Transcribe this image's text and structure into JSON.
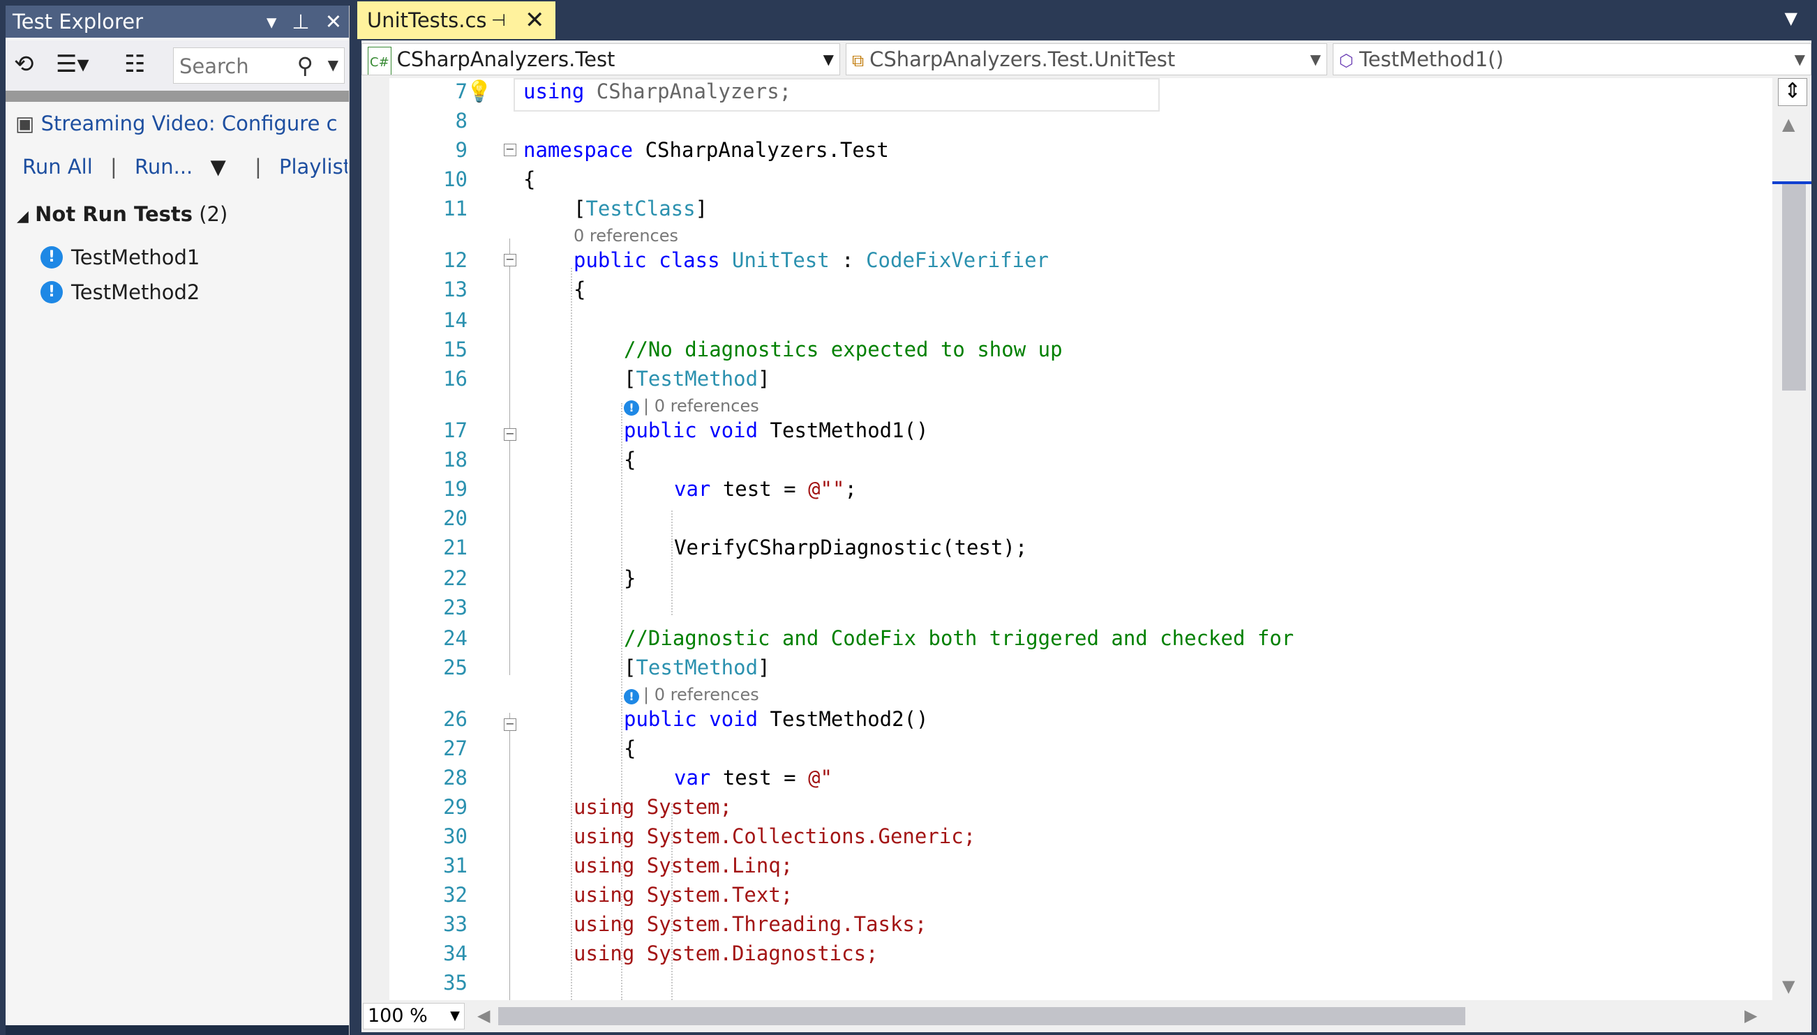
{
  "test_explorer": {
    "title": "Test Explorer",
    "search_placeholder": "Search",
    "playlist_label": "Streaming Video: Configure c",
    "actions": {
      "run_all": "Run All",
      "run": "Run...",
      "playlist": "Playlist : All T"
    },
    "group": {
      "label": "Not Run Tests",
      "count": "(2)"
    },
    "tests": [
      "TestMethod1",
      "TestMethod2"
    ]
  },
  "editor": {
    "tab": {
      "title": "UnitTests.cs"
    },
    "nav": {
      "project": "CSharpAnalyzers.Test",
      "type": "CSharpAnalyzers.Test.UnitTest",
      "member": "TestMethod1()"
    },
    "zoom": "100 %",
    "references_label": "0 references",
    "line_numbers": [
      "7",
      "8",
      "9",
      "10",
      "11",
      "12",
      "13",
      "14",
      "15",
      "16",
      "17",
      "18",
      "19",
      "20",
      "21",
      "22",
      "23",
      "24",
      "25",
      "26",
      "27",
      "28",
      "29",
      "30",
      "31",
      "32",
      "33",
      "34",
      "35"
    ],
    "code": {
      "l7_kw": "using",
      "l7_rest": " CSharpAnalyzers;",
      "l9_kw": "namespace",
      "l9_rest": " CSharpAnalyzers.Test",
      "l10": "{",
      "l11_a": "[",
      "l11_t": "TestClass",
      "l11_b": "]",
      "l12_kw1": "public",
      "l12_kw2": "class",
      "l12_t": "UnitTest",
      "l12_sep": " : ",
      "l12_base": "CodeFixVerifier",
      "l13": "{",
      "l15": "//No diagnostics expected to show up",
      "l16_a": "[",
      "l16_t": "TestMethod",
      "l16_b": "]",
      "l17_kw1": "public",
      "l17_kw2": "void",
      "l17_rest": " TestMethod1()",
      "l18": "{",
      "l19_kw": "var",
      "l19_rest": " test = ",
      "l19_str": "@\"\"",
      "l19_end": ";",
      "l21": "VerifyCSharpDiagnostic(test);",
      "l22": "}",
      "l24": "//Diagnostic and CodeFix both triggered and checked for",
      "l25_a": "[",
      "l25_t": "TestMethod",
      "l25_b": "]",
      "l26_kw1": "public",
      "l26_kw2": "void",
      "l26_rest": " TestMethod2()",
      "l27": "{",
      "l28_kw": "var",
      "l28_rest": " test = ",
      "l28_str": "@\"",
      "l29": "using System;",
      "l30": "using System.Collections.Generic;",
      "l31": "using System.Linq;",
      "l32": "using System.Text;",
      "l33": "using System.Threading.Tasks;",
      "l34": "using System.Diagnostics;"
    }
  }
}
